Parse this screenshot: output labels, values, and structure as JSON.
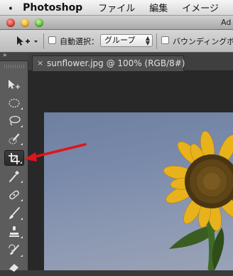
{
  "menubar": {
    "apple_icon": "apple-logo-icon",
    "app_name": "Photoshop",
    "items": [
      "ファイル",
      "編集",
      "イメージ"
    ]
  },
  "window": {
    "title": "Ad",
    "buttons": [
      "close-button",
      "minimize-button",
      "zoom-button"
    ]
  },
  "options_bar": {
    "tool_icon": "move-tool-icon",
    "auto_select_label": "自動選択：",
    "auto_select_checked": false,
    "group_select": "グループ",
    "bounding_box_label": "バウンディングボ",
    "bounding_box_checked": false
  },
  "tools": {
    "collapse_glyph": "»",
    "items": [
      {
        "name": "move-tool",
        "icon": "move-icon",
        "active": false
      },
      {
        "name": "marquee-tool",
        "icon": "elliptical-marquee-icon",
        "active": false
      },
      {
        "name": "lasso-tool",
        "icon": "lasso-icon",
        "active": false
      },
      {
        "name": "quick-selection-tool",
        "icon": "quick-selection-icon",
        "active": false
      },
      {
        "name": "crop-tool",
        "icon": "crop-icon",
        "active": true
      },
      {
        "name": "eyedropper-tool",
        "icon": "eyedropper-icon",
        "active": false
      },
      {
        "name": "healing-brush-tool",
        "icon": "bandage-icon",
        "active": false
      },
      {
        "name": "brush-tool",
        "icon": "brush-icon",
        "active": false
      },
      {
        "name": "clone-stamp-tool",
        "icon": "stamp-icon",
        "active": false
      },
      {
        "name": "history-brush-tool",
        "icon": "history-brush-icon",
        "active": false
      },
      {
        "name": "eraser-tool",
        "icon": "eraser-icon",
        "active": false
      }
    ]
  },
  "document": {
    "tab_close": "×",
    "tab_title": "sunflower.jpg @ 100% (RGB/8#)"
  },
  "annotation": {
    "arrow_color": "#e0141b",
    "points_to": "crop-tool"
  }
}
